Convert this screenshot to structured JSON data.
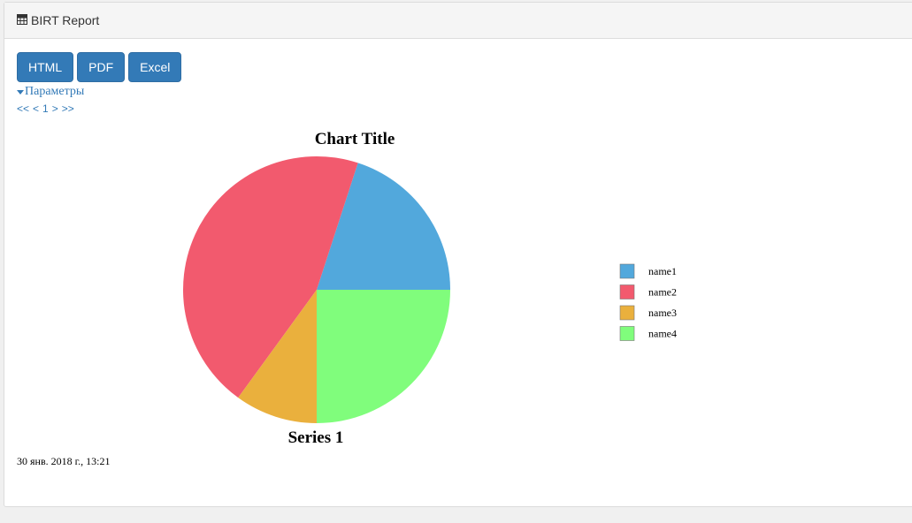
{
  "header": {
    "icon": "table-icon",
    "title": "BIRT Report"
  },
  "toolbar": {
    "buttons": [
      "HTML",
      "PDF",
      "Excel"
    ],
    "accent": "#337ab7"
  },
  "parameters_link": "Параметры",
  "pager": {
    "first": "<<",
    "prev": "<",
    "current": "1",
    "next": ">",
    "last": ">>"
  },
  "chart_data": {
    "type": "pie",
    "title": "Chart Title",
    "series_label": "Series 1",
    "slices": [
      {
        "name": "name1",
        "value": 20,
        "color": "#52a8dc"
      },
      {
        "name": "name2",
        "value": 45,
        "color": "#f25a6e"
      },
      {
        "name": "name3",
        "value": 10,
        "color": "#eab03d"
      },
      {
        "name": "name4",
        "value": 25,
        "color": "#80fd7c"
      }
    ],
    "legend_position": "right"
  },
  "footer": {
    "timestamp": "30 янв. 2018 г., 13:21"
  }
}
